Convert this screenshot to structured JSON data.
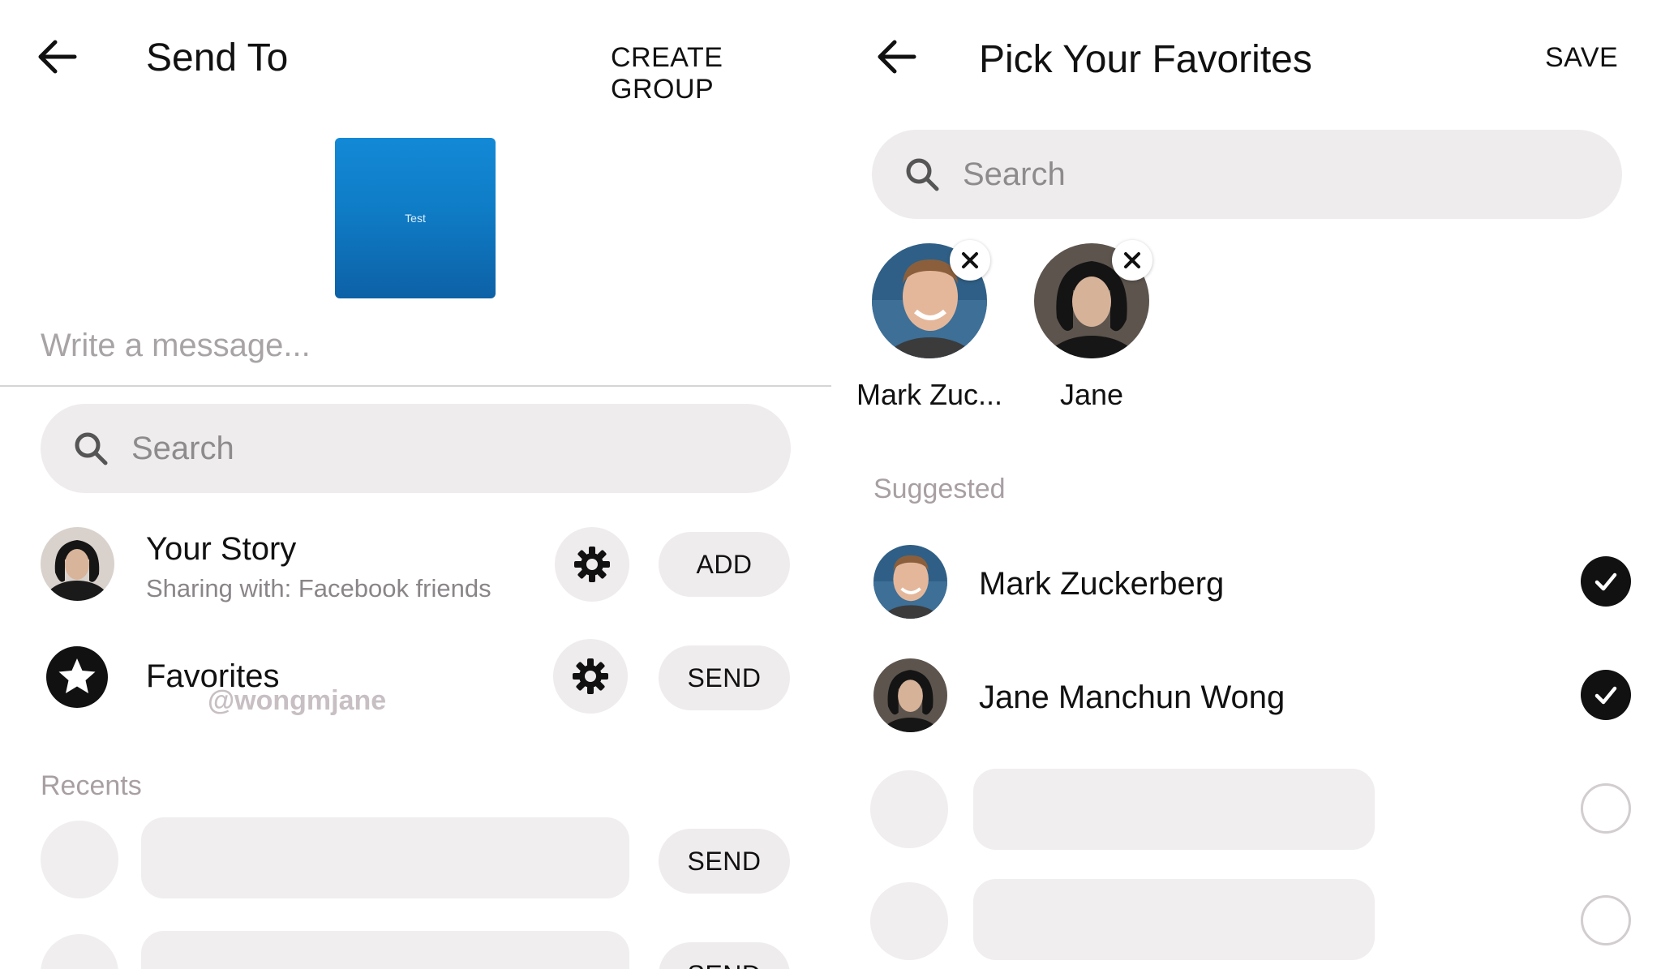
{
  "left": {
    "header": {
      "title": "Send To",
      "action": "CREATE GROUP"
    },
    "preview": {
      "thumbnail_text": "Test"
    },
    "message": {
      "placeholder": "Write a message..."
    },
    "search": {
      "placeholder": "Search"
    },
    "story": {
      "name": "Your Story",
      "subtitle": "Sharing with: Facebook friends",
      "button": "ADD"
    },
    "favorites": {
      "name": "Favorites",
      "button": "SEND",
      "watermark": "@wongmjane"
    },
    "recents": {
      "label": "Recents",
      "items": [
        {
          "button": "SEND"
        },
        {
          "button": "SEND"
        }
      ]
    }
  },
  "right": {
    "header": {
      "title": "Pick Your Favorites",
      "action": "SAVE"
    },
    "search": {
      "placeholder": "Search"
    },
    "selected": [
      {
        "name": "Mark Zuc..."
      },
      {
        "name": "Jane"
      }
    ],
    "suggested": {
      "label": "Suggested",
      "items": [
        {
          "name": "Mark Zuckerberg",
          "checked": true
        },
        {
          "name": "Jane Manchun Wong",
          "checked": true
        },
        {
          "name": "",
          "checked": false
        },
        {
          "name": "",
          "checked": false
        }
      ]
    }
  },
  "colors": {
    "thumbnail_blue": "#0f7cc6",
    "pill_gray": "#efeced",
    "muted_text": "#8a8588"
  },
  "icons": [
    "back-arrow-icon",
    "search-icon",
    "gear-icon",
    "star-icon",
    "close-icon",
    "checkmark-icon"
  ]
}
